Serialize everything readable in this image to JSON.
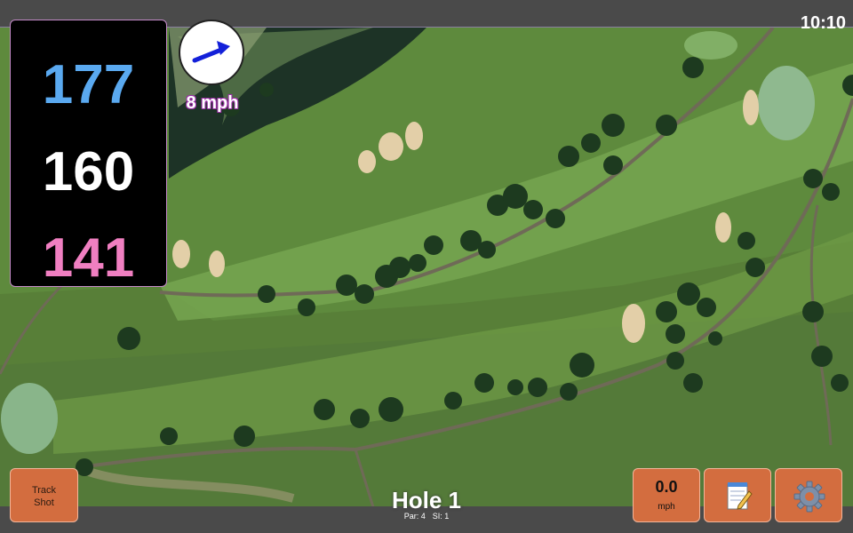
{
  "status_bar": {
    "time": "10:10"
  },
  "distances": {
    "back": "177",
    "center": "160",
    "front": "141",
    "colors": {
      "back": "#5aa9f0",
      "center": "#ffffff",
      "front": "#f07fc1"
    }
  },
  "wind": {
    "speed_label": "8 mph",
    "arrow_icon": "wind-direction-arrow-icon"
  },
  "buttons": {
    "track_shot": {
      "line1": "Track",
      "line2": "Shot"
    },
    "speed": {
      "value": "0.0",
      "unit": "mph"
    },
    "notes": {
      "icon": "notepad-pencil-icon"
    },
    "settings": {
      "icon": "gear-icon"
    }
  },
  "hole": {
    "title": "Hole 1",
    "par_label": "Par: 4",
    "si_label": "SI: 1"
  },
  "theme": {
    "button_color": "#d36d3f",
    "bar_color": "#4a4a4a"
  }
}
